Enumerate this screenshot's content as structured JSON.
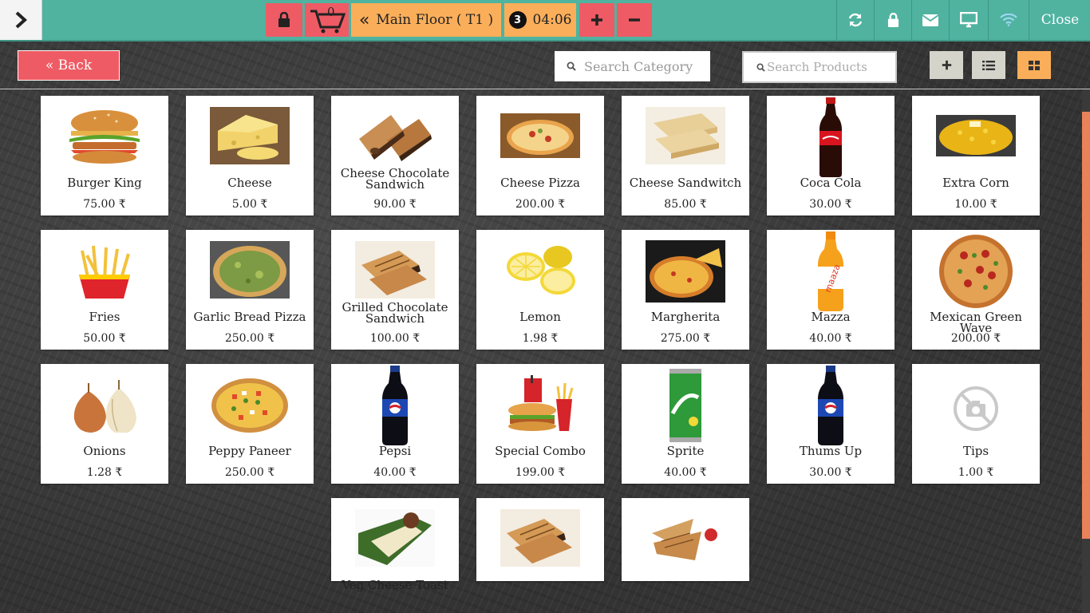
{
  "topbar": {
    "cart_count": "0",
    "floor_label": "Main Floor ( T1 )",
    "order_count": "3",
    "timer": "04:06",
    "close_label": "Close"
  },
  "toolbar": {
    "back_label": "« Back",
    "search_category_placeholder": "Search Category",
    "search_products_placeholder": "Search Products"
  },
  "colors": {
    "topbar": "#4fb3a0",
    "red_button": "#ee5b64",
    "orange_button": "#fbae5a",
    "gray_button": "#d4d4cb"
  },
  "products": [
    {
      "name": "Burger King",
      "price": "75.00 ₹",
      "icon": "burger"
    },
    {
      "name": "Cheese",
      "price": "5.00 ₹",
      "icon": "cheese"
    },
    {
      "name": "Cheese Chocolate Sandwich",
      "price": "90.00 ₹",
      "icon": "sandwich-dark"
    },
    {
      "name": "Cheese Pizza",
      "price": "200.00 ₹",
      "icon": "pizza"
    },
    {
      "name": "Cheese Sandwitch",
      "price": "85.00 ₹",
      "icon": "sandwich-stack"
    },
    {
      "name": "Coca Cola",
      "price": "30.00 ₹",
      "icon": "bottle-red"
    },
    {
      "name": "Extra Corn",
      "price": "10.00 ₹",
      "icon": "corn"
    },
    {
      "name": "Fries",
      "price": "50.00 ₹",
      "icon": "fries"
    },
    {
      "name": "Garlic Bread Pizza",
      "price": "250.00 ₹",
      "icon": "pizza-green"
    },
    {
      "name": "Grilled Chocolate Sandwich",
      "price": "100.00 ₹",
      "icon": "sandwich-grilled"
    },
    {
      "name": "Lemon",
      "price": "1.98 ₹",
      "icon": "lemon"
    },
    {
      "name": "Margherita",
      "price": "275.00 ₹",
      "icon": "pizza-dark"
    },
    {
      "name": "Mazza",
      "price": "40.00 ₹",
      "icon": "bottle-orange"
    },
    {
      "name": "Mexican Green Wave",
      "price": "200.00 ₹",
      "icon": "pizza-round"
    },
    {
      "name": "Onions",
      "price": "1.28 ₹",
      "icon": "onion"
    },
    {
      "name": "Peppy Paneer",
      "price": "250.00 ₹",
      "icon": "pizza-paneer"
    },
    {
      "name": "Pepsi",
      "price": "40.00 ₹",
      "icon": "bottle-blue"
    },
    {
      "name": "Special Combo",
      "price": "199.00 ₹",
      "icon": "combo"
    },
    {
      "name": "Sprite",
      "price": "40.00 ₹",
      "icon": "can-green"
    },
    {
      "name": "Thums Up",
      "price": "30.00 ₹",
      "icon": "bottle-blue"
    },
    {
      "name": "Tips",
      "price": "1.00 ₹",
      "icon": "no-image"
    },
    {
      "name": "Veg Cheese Toast",
      "price": "",
      "icon": "toast"
    },
    {
      "name": "",
      "price": "",
      "icon": "sandwich-grilled"
    },
    {
      "name": "",
      "price": "",
      "icon": "sandwich-triangle"
    }
  ]
}
